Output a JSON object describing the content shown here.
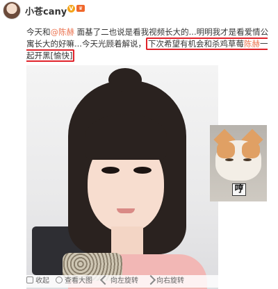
{
  "header": {
    "username": "小苍cany",
    "verified_badge": "V",
    "crown_badge": "♛"
  },
  "post": {
    "line1_prefix": "今天和",
    "mention1": "@陈赫",
    "line1_rest": " 面基了二也说是看我视频长大的...明明我才是看爱情公寓长大的好嘛...今天光顾着解说，",
    "highlight_prefix": "下次希望有机会和杀鸡草莓",
    "mention2": "陈赫",
    "highlight_suffix": "一起开黑[愉快]"
  },
  "thumbnail": {
    "caption": "哼"
  },
  "actions": {
    "collapse": "收起",
    "zoom": "查看大图",
    "rotate_left": "向左旋转",
    "rotate_right": "向右旋转"
  }
}
